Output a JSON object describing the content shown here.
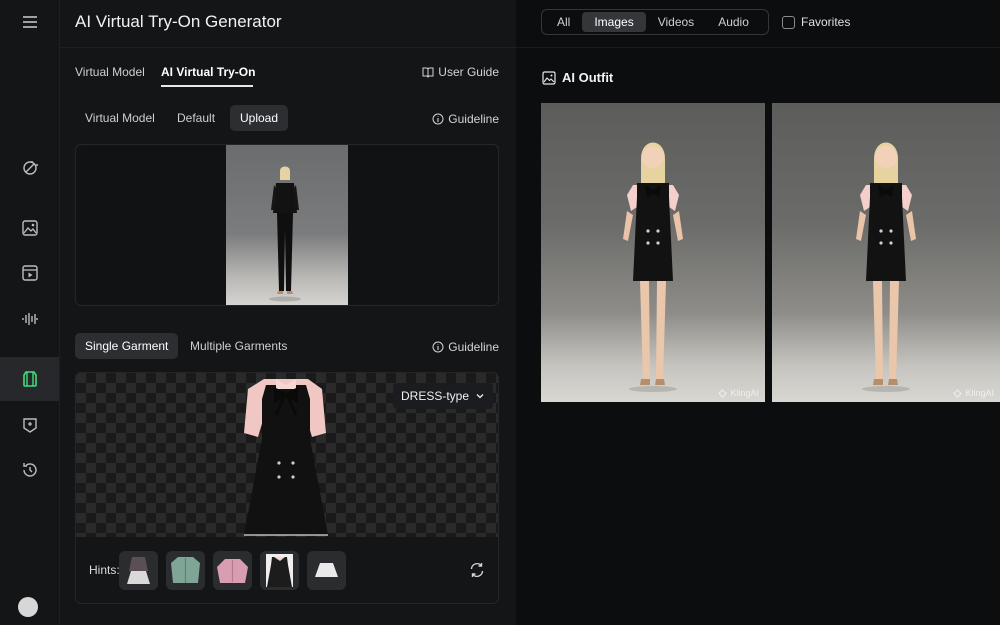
{
  "sidebar": {
    "menu_icon": "hamburger-icon",
    "items": [
      {
        "name": "sidebar-item-magic",
        "icon": "magic-wand-icon"
      },
      {
        "name": "sidebar-item-image",
        "icon": "image-icon"
      },
      {
        "name": "sidebar-item-video",
        "icon": "video-icon"
      },
      {
        "name": "sidebar-item-audio",
        "icon": "audio-wave-icon"
      },
      {
        "name": "sidebar-item-try-on",
        "icon": "try-on-icon",
        "active": true
      },
      {
        "name": "sidebar-item-effects",
        "icon": "effects-icon"
      },
      {
        "name": "sidebar-item-history",
        "icon": "history-icon"
      }
    ]
  },
  "panel": {
    "title": "AI Virtual Try-On Generator",
    "tabs": [
      {
        "label": "Virtual Model",
        "active": false
      },
      {
        "label": "AI Virtual Try-On",
        "active": true
      }
    ],
    "user_guide": "User Guide",
    "model_source": {
      "options": [
        {
          "label": "Virtual Model",
          "active": false
        },
        {
          "label": "Default",
          "active": false
        },
        {
          "label": "Upload",
          "active": true
        }
      ],
      "guideline": "Guideline"
    },
    "garment_mode": {
      "options": [
        {
          "label": "Single Garment",
          "active": true
        },
        {
          "label": "Multiple Garments",
          "active": false
        }
      ],
      "guideline": "Guideline"
    },
    "garment_type": "DRESS-type",
    "hints_label": "Hints:",
    "hints": [
      {
        "name": "hint-top-skirt",
        "color": "#5a4f55"
      },
      {
        "name": "hint-green-jacket",
        "color": "#7fa596"
      },
      {
        "name": "hint-pink-jacket",
        "color": "#d89db0"
      },
      {
        "name": "hint-dress",
        "color": "#1c1c1c"
      },
      {
        "name": "hint-white-skirt",
        "color": "#e9e9e9"
      }
    ]
  },
  "right": {
    "filters": [
      {
        "label": "All",
        "active": false
      },
      {
        "label": "Images",
        "active": true
      },
      {
        "label": "Videos",
        "active": false
      },
      {
        "label": "Audio",
        "active": false
      }
    ],
    "favorites_label": "Favorites",
    "section_title": "AI Outfit",
    "results": [
      {
        "watermark": "KlingAI"
      },
      {
        "watermark": "KlingAI"
      }
    ]
  },
  "colors": {
    "accent_active": "#3fe07a",
    "panel_bg": "#141517",
    "app_bg": "#0d0e10"
  }
}
